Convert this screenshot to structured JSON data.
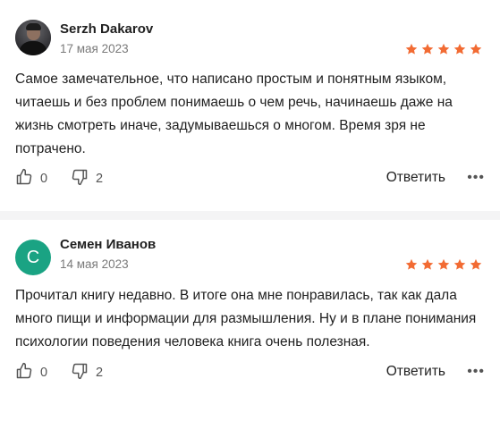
{
  "reviews": [
    {
      "author": "Serzh Dakarov",
      "date": "17 мая 2023",
      "avatar_type": "photo",
      "rating": 5,
      "text": "Самое замечательное, что написано простым и понятным языком, читаешь и без проблем понимаешь о чем речь, начинаешь даже на жизнь смотреть иначе, задумываешься о многом. Время зря не потрачено.",
      "likes": "0",
      "dislikes": "2",
      "reply_label": "Ответить",
      "more_label": "•••"
    },
    {
      "author": "Семен Иванов",
      "date": "14 мая 2023",
      "avatar_type": "letter",
      "avatar_letter": "С",
      "rating": 5,
      "text": "Прочитал книгу недавно. В итоге она мне понравилась, так как дала много пищи и информации для размышления. Ну и в плане понимания психологии поведения человека книга очень полезная.",
      "likes": "0",
      "dislikes": "2",
      "reply_label": "Ответить",
      "more_label": "•••"
    }
  ],
  "colors": {
    "star": "#f26b33",
    "avatar_letter_bg": "#1aa383",
    "muted_text": "#7a7a7a"
  }
}
